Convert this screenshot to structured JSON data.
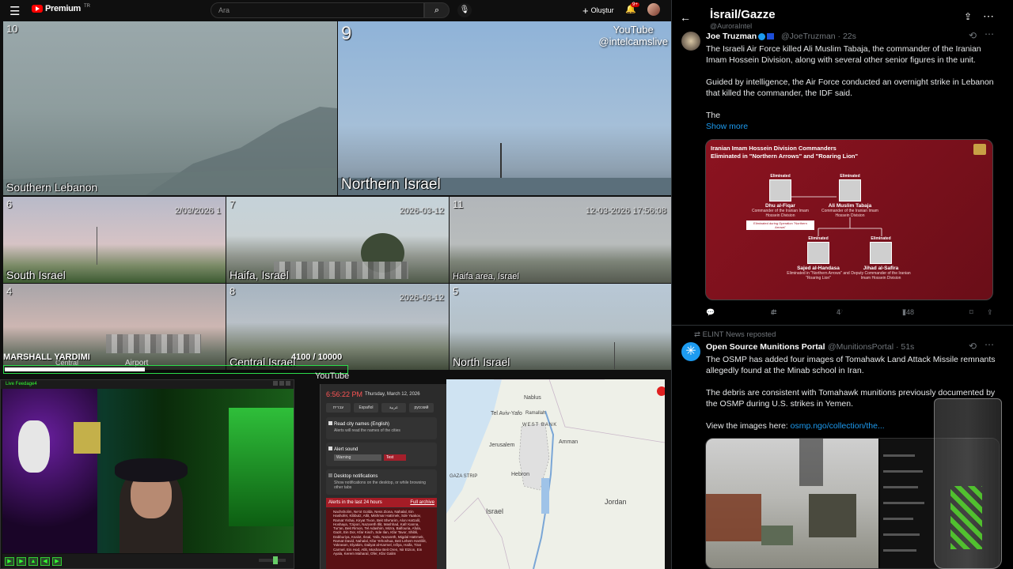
{
  "youtube": {
    "logo_text": "Premium",
    "logo_sup": "TR",
    "search_placeholder": "Ara",
    "create_label": "Oluştur",
    "notif_badge": "9+"
  },
  "cameras": {
    "cam10": {
      "num": "10",
      "label": "Southern Lebanon"
    },
    "cam9": {
      "num": "9",
      "label": "Northern Israel",
      "watermark_line1": "YouTube",
      "watermark_line2": "@intelcamslive"
    },
    "cam6": {
      "num": "6",
      "label": "South Israel",
      "timestamp": "2/03/2026 1"
    },
    "cam7": {
      "num": "7",
      "label": "Haifa, Israel",
      "timestamp": "2026-03-12"
    },
    "cam11": {
      "num": "11",
      "label": "Haifa area, Israel",
      "timestamp": "12-03-2026 17:56:08"
    },
    "cam4": {
      "num": "4",
      "label": "Airport",
      "sublabel": "Central"
    },
    "cam8": {
      "num": "8",
      "label": "Central Israel",
      "timestamp": "2026-03-12"
    },
    "cam5": {
      "num": "5",
      "label": "North Israel"
    }
  },
  "overlay": {
    "title": "MARSHALL YARDIMI",
    "count": "4100",
    "goal": "10000",
    "progress": 0.41,
    "source": "YouTube"
  },
  "webcam": {
    "title": "Live Feedage4",
    "buttons": [
      "▶",
      "▶",
      "▲",
      "◀",
      "▶"
    ]
  },
  "alerts": {
    "time": "6:56:22 PM",
    "date": "Thursday, March 12, 2026",
    "languages": [
      "עברית",
      "Español",
      "عربية",
      "русский"
    ],
    "opt1_label": "Read city names (English)",
    "opt1_desc": "Alerts will read the names of the cities",
    "opt2_label": "Alert sound",
    "opt2_select": "Warning",
    "opt2_test": "Test",
    "opt3_label": "Desktop notifications",
    "opt3_desc": "Show notifications on the desktop, or while browsing other tabs",
    "list_title": "Alerts in the last 24 hours",
    "list_link": "Full archive",
    "list_text": "Nachsholim, Ne'ot Golda, Ness Ziona, Nahalal, Ein Hashofet, Kibbutz, Atlit, Mishmar HaEmek, Sde Yaakov, Ramat Yishai, Kiryat Tivon, Beit She'arim, Alon HaGalil, Hoshaya, Tzipori, Nazareth Illit, Mashhad, Kafr Kanna, Tur'an, Beit Rimon, Tel Adashim, Mizra, Balfouria, Afula, Gazit, Ein Dor, Kfar Kisch, Sde Ilan, Kfar Tavor, Shibli, Dabburiya, Ksalot, Iksal, Yafa, Nazareth, Migdal HaEmek, Ramat David, Nahalal, Kfar Yehoshua, Beit Lehem HaGlilit, Yokneam, Elyakim, Daliyat al-Karmel, Isfiya, Haifa, Tirat Carmel, Ein Hod, Atlit, Moshav Beit Oren, Nir Etzion, Ein Ayala, Kerem Maharal, Ofer, Kfar Galim"
  },
  "map": {
    "labels": [
      "Tel Aviv-Yafo",
      "WEST BANK",
      "Amman",
      "Jerusalem",
      "Hebron",
      "GAZA STRIP",
      "Israel",
      "Jordan",
      "Nablus",
      "Ramallah"
    ]
  },
  "twitter": {
    "header_title": "İsrail/Gazze",
    "header_handle": "@AuroraIntel",
    "tweet1": {
      "name": "Joe Truzman",
      "handle": "@JoeTruzman",
      "time": "22s",
      "para1": "The Israeli Air Force killed Ali Muslim Tabaja, the commander of the Iranian Imam Hossein Division, along with several other senior figures in the unit.",
      "para2": "Guided by intelligence, the Air Force conducted an overnight strike in Lebanon that killed the commander, the IDF said.",
      "para3": "The",
      "show_more": "Show more",
      "replies": "",
      "retweets": "4",
      "likes": "4",
      "views": "748"
    },
    "infographic": {
      "title_line1": "Iranian Imam Hossein Division Commanders",
      "title_line2": "Eliminated in \"Northern Arrows\" and \"Roaring Lion\"",
      "tag": "Eliminated",
      "p1_name": "Dhu al-Fiqar",
      "p1_role": "Commander of the Iranian Imam Hossein Division",
      "p1_note": "Eliminated during Operation \"Northern Arrows\"",
      "p2_name": "Ali Muslim Tabaja",
      "p2_role": "Commander of the Iranian Imam Hossein Division",
      "p3_name": "Sajed al-Handasa",
      "p3_role": "Eliminated in \"Northern Arrows\" and \"Roaring Lion\"",
      "p4_name": "Jihad al-Safira",
      "p4_role": "Deputy Commander of the Iranian Imam Hossein Division"
    },
    "tweet2": {
      "reposted_by": "ELINT News reposted",
      "name": "Open Source Munitions Portal",
      "handle": "@MunitionsPortal",
      "time": "51s",
      "para1": "The OSMP has added four images of Tomahawk Land Attack Missile remnants allegedly found at the Minab school in Iran.",
      "para2": "The debris are consistent with Tomahawk munitions previously documented by the OSMP during U.S. strikes in Yemen.",
      "para3_prefix": "View the images here:",
      "link": "osmp.ngo/collection/the..."
    }
  }
}
